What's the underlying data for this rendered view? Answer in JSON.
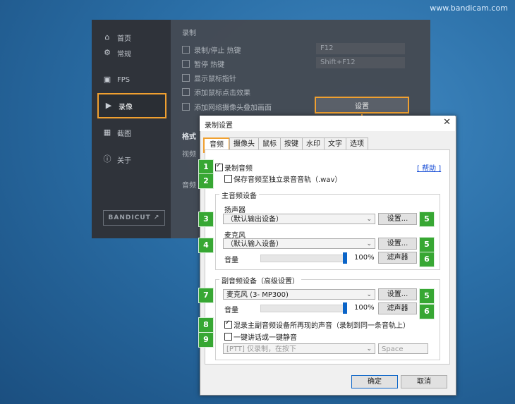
{
  "watermark": "www.bandicam.com",
  "background_app": {
    "nav": [
      {
        "label": "首页",
        "icon": "home-icon"
      },
      {
        "label": "常规",
        "icon": "gear-icon"
      },
      {
        "label": "FPS",
        "icon": "fps-icon"
      },
      {
        "label": "录像",
        "icon": "video-record-icon"
      },
      {
        "label": "截图",
        "icon": "image-icon"
      },
      {
        "label": "关于",
        "icon": "info-icon"
      }
    ],
    "section_label": "录制",
    "options": [
      "录制/停止 热键",
      "暂停 热键",
      "显示鼠标指针",
      "添加鼠标点击效果",
      "添加网络摄像头叠加画面"
    ],
    "hotkey1": "F12",
    "hotkey2": "Shift+F12",
    "settings_button": "设置",
    "format_label": "格式",
    "video_label": "视频",
    "audio_label": "音频",
    "bandicut": "BANDICUT ↗"
  },
  "dialog": {
    "title": "录制设置",
    "tabs": [
      "音频",
      "摄像头",
      "鼠标",
      "按键",
      "水印",
      "文字",
      "选项"
    ],
    "record_audio": "录制音频",
    "help_link": "[ 帮助 ]",
    "save_separate": "保存音频至独立录音音轨（.wav）",
    "primary_group": "主音频设备",
    "speaker_label": "扬声器",
    "speaker_value": "（默认输出设备）",
    "settings_btn": "设置...",
    "mic_label": "麦克风",
    "mic_value": "（默认输入设备）",
    "volume_label": "音量",
    "volume_pct": "100%",
    "filter_btn": "滤声器",
    "secondary_group": "副音频设备（高级设置）",
    "secondary_mic_value": "麦克风 (3- MP300)",
    "secondary_volume_pct": "100%",
    "mix_label": "混录主副音频设备所再现的声音（录制到同一条音轨上）",
    "ptt_label": "一键讲话或一键静音",
    "ptt_value": "[PTT] 仅录制，在按下",
    "ptt_key": "Space",
    "ok": "确定",
    "cancel": "取消"
  },
  "badges": [
    "1",
    "2",
    "3",
    "4",
    "5",
    "5",
    "6",
    "7",
    "5",
    "6",
    "8",
    "9"
  ],
  "colors": {
    "highlight": "#f0a030",
    "badge": "#37a733",
    "accent": "#0a64c8"
  }
}
